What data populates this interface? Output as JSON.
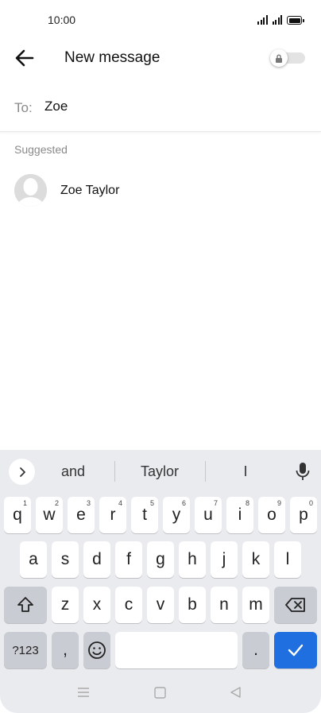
{
  "status_bar": {
    "time": "10:00",
    "icons": [
      "signal-icon",
      "signal-icon",
      "battery-icon"
    ]
  },
  "header": {
    "title": "New message",
    "back_icon": "arrow-back-icon",
    "toggle_icon": "lock-icon"
  },
  "recipient": {
    "label": "To:",
    "value": "Zoe"
  },
  "suggestions": {
    "heading": "Suggested",
    "contacts": [
      {
        "name": "Zoe Taylor"
      }
    ]
  },
  "keyboard": {
    "word_suggestions": [
      "and",
      "Taylor",
      "I"
    ],
    "row1": [
      {
        "key": "q",
        "num": "1"
      },
      {
        "key": "w",
        "num": "2"
      },
      {
        "key": "e",
        "num": "3"
      },
      {
        "key": "r",
        "num": "4"
      },
      {
        "key": "t",
        "num": "5"
      },
      {
        "key": "y",
        "num": "6"
      },
      {
        "key": "u",
        "num": "7"
      },
      {
        "key": "i",
        "num": "8"
      },
      {
        "key": "o",
        "num": "9"
      },
      {
        "key": "p",
        "num": "0"
      }
    ],
    "row2": [
      "a",
      "s",
      "d",
      "f",
      "g",
      "h",
      "j",
      "k",
      "l"
    ],
    "row3": [
      "z",
      "x",
      "c",
      "v",
      "b",
      "n",
      "m"
    ],
    "symbols_label": "?123",
    "comma": ",",
    "period": ".",
    "accent_color": "#1f6fe0"
  }
}
